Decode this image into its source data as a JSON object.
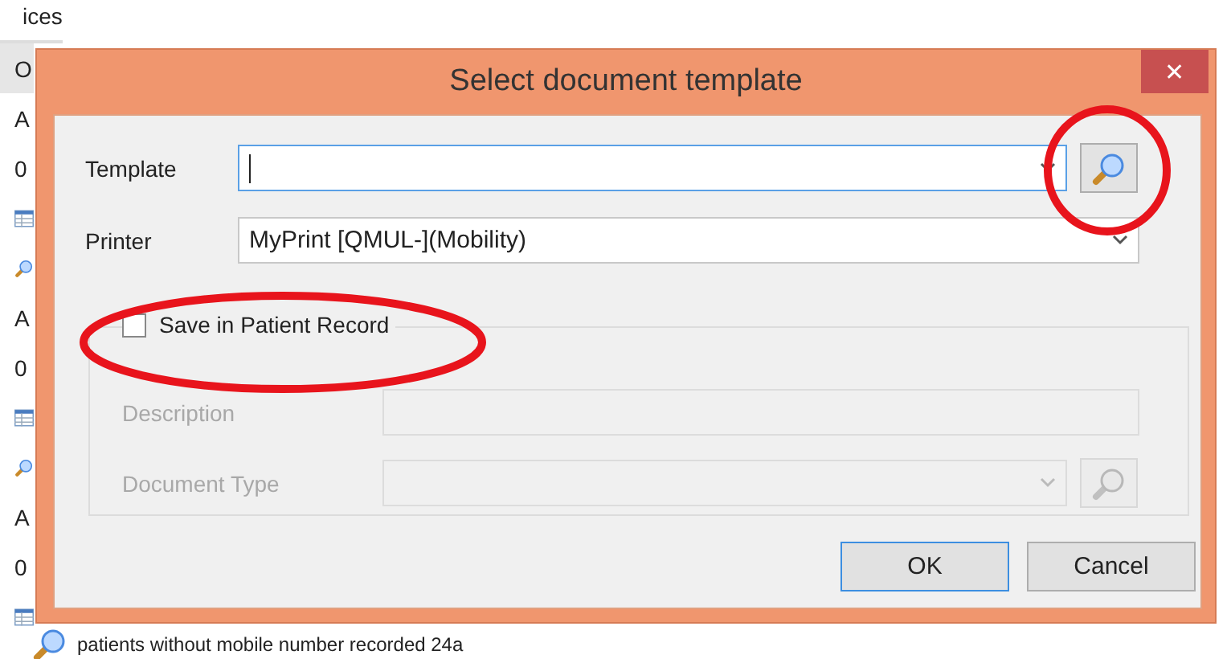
{
  "background": {
    "header": "ices",
    "rows": [
      {
        "kind": "text",
        "text": "O",
        "selected": true
      },
      {
        "kind": "text",
        "text": "A",
        "selected": false
      },
      {
        "kind": "text",
        "text": "0",
        "selected": false
      },
      {
        "kind": "grid",
        "selected": false
      },
      {
        "kind": "search",
        "selected": false
      },
      {
        "kind": "text",
        "text": "A",
        "selected": false
      },
      {
        "kind": "text",
        "text": "0",
        "selected": false
      },
      {
        "kind": "grid",
        "selected": false
      },
      {
        "kind": "search",
        "selected": false
      },
      {
        "kind": "text",
        "text": "A",
        "selected": false
      },
      {
        "kind": "text",
        "text": "0",
        "selected": false
      },
      {
        "kind": "grid",
        "selected": false
      }
    ],
    "footer": "patients without mobile number recorded 24a"
  },
  "dialog": {
    "title": "Select document template",
    "close": "✕",
    "template": {
      "label": "Template",
      "focused": true,
      "disabled": false
    },
    "printer": {
      "label": "Printer",
      "value": "MyPrint [QMUL-](Mobility)",
      "disabled": false
    },
    "save_in_record": {
      "label": "Save in Patient Record",
      "checked": false
    },
    "description": {
      "label": "Description",
      "disabled": true
    },
    "document_type": {
      "label": "Document Type",
      "disabled": true
    },
    "buttons": [
      {
        "label": "OK",
        "default": true
      },
      {
        "label": "Cancel",
        "default": false
      }
    ]
  },
  "annotations": [
    {
      "kind": "ellipse"
    },
    {
      "kind": "ellipse"
    }
  ]
}
